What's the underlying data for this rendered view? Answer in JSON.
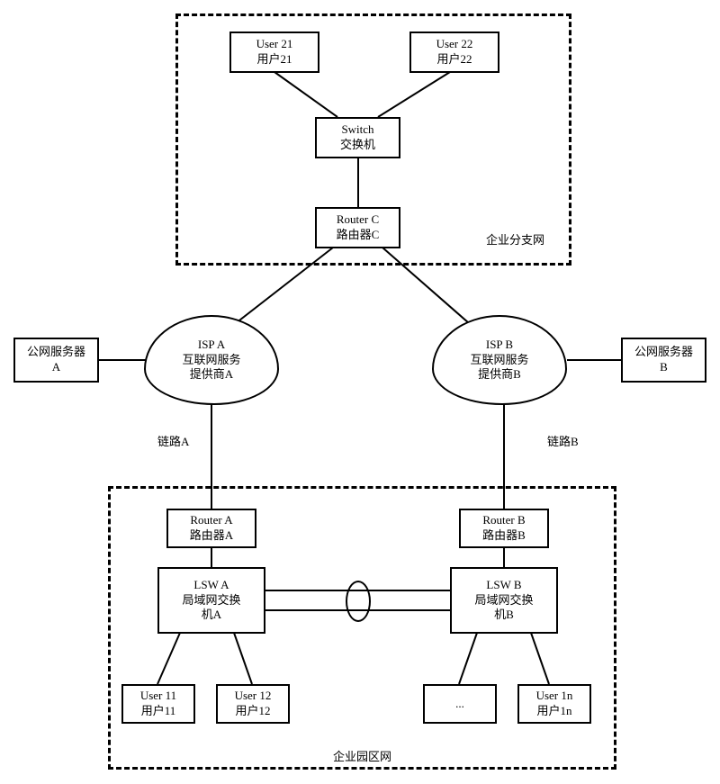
{
  "branch": {
    "label": "企业分支网",
    "user21": {
      "en": "User 21",
      "zh": "用户21"
    },
    "user22": {
      "en": "User 22",
      "zh": "用户22"
    },
    "switch": {
      "en": "Switch",
      "zh": "交换机"
    },
    "routerC": {
      "en": "Router C",
      "zh": "路由器C"
    }
  },
  "ispA": {
    "en": "ISP A",
    "zh1": "互联网服务",
    "zh2": "提供商A"
  },
  "ispB": {
    "en": "ISP B",
    "zh1": "互联网服务",
    "zh2": "提供商B"
  },
  "serverA": {
    "line1": "公网服务器",
    "line2": "A"
  },
  "serverB": {
    "line1": "公网服务器",
    "line2": "B"
  },
  "linkA": "链路A",
  "linkB": "链路B",
  "campus": {
    "label": "企业园区网",
    "routerA": {
      "en": "Router A",
      "zh": "路由器A"
    },
    "routerB": {
      "en": "Router B",
      "zh": "路由器B"
    },
    "lswA": {
      "en": "LSW A",
      "zh1": "局域网交换",
      "zh2": "机A"
    },
    "lswB": {
      "en": "LSW B",
      "zh1": "局域网交换",
      "zh2": "机B"
    },
    "user11": {
      "en": "User 11",
      "zh": "用户11"
    },
    "user12": {
      "en": "User 12",
      "zh": "用户12"
    },
    "dots": "...",
    "user1n": {
      "en": "User 1n",
      "zh": "用户1n"
    }
  }
}
